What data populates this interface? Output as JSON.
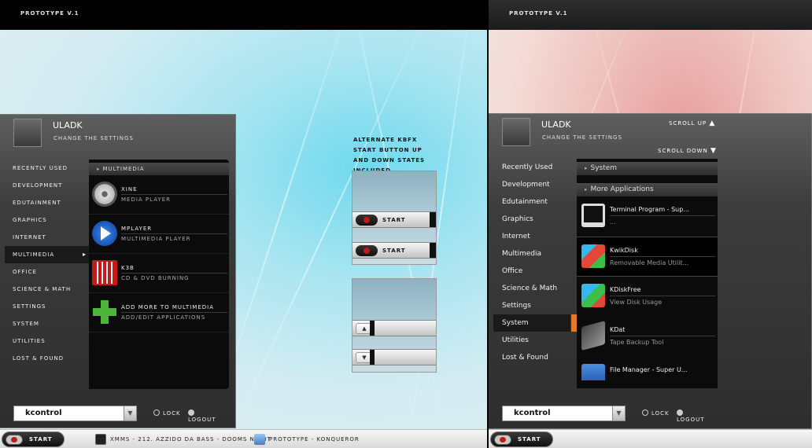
{
  "left": {
    "title": "PROTOTYPE V.1",
    "menu": {
      "user": "ULADK",
      "subtitle": "CHANGE THE SETTINGS",
      "categories": [
        "RECENTLY USED",
        "DEVELOPMENT",
        "EDUTAINMENT",
        "GRAPHICS",
        "INTERNET",
        "MULTIMEDIA",
        "OFFICE",
        "SCIENCE & MATH",
        "SETTINGS",
        "SYSTEM",
        "UTILITIES",
        "LOST & FOUND"
      ],
      "selected_category": "MULTIMEDIA",
      "section": "MULTIMEDIA",
      "apps": [
        {
          "name": "XINE",
          "desc": "MEDIA PLAYER",
          "icon": "xine-disc-icon"
        },
        {
          "name": "MPLAYER",
          "desc": "MULTIMEDIA PLAYER",
          "icon": "mplayer-play-icon"
        },
        {
          "name": "K3B",
          "desc": "CD & DVD BURNING",
          "icon": "k3b-icon"
        },
        {
          "name": "ADD MORE TO MULTIMEDIA",
          "desc": "ADD/EDIT APPLICATIONS",
          "icon": "add-plus-icon"
        }
      ],
      "command_value": "kcontrol",
      "lock": "LOCK",
      "logout": "LOGOUT"
    },
    "note": "ALTERNATE KBFX START BUTTON UP AND DOWN STATES INCLUDED",
    "start_label": "START",
    "taskbar": {
      "start": "START",
      "tasks": [
        "XMMS - 212. AZZIDO DA BASS - DOOMS NIGHT",
        "PROTOTYPE - KONQUEROR"
      ]
    }
  },
  "right": {
    "title": "PROTOTYPE V.1",
    "menu": {
      "user": "ULADK",
      "subtitle": "CHANGE THE SETTINGS",
      "scroll_up": "SCROLL UP",
      "scroll_down": "SCROLL DOWN",
      "categories": [
        "Recently Used",
        "Development",
        "Edutainment",
        "Graphics",
        "Internet",
        "Multimedia",
        "Office",
        "Science & Math",
        "Settings",
        "System",
        "Utilities",
        "Lost & Found"
      ],
      "selected_category": "System",
      "section1": "System",
      "section2": "More Applications",
      "apps": [
        {
          "name": "Terminal Program - Sup...",
          "desc": "...",
          "icon": "terminal-icon"
        },
        {
          "name": "KwikDisk",
          "desc": "Removable Media Utilit...",
          "icon": "kwikdisk-cubes-icon"
        },
        {
          "name": "KDiskFree",
          "desc": "View Disk Usage",
          "icon": "kdiskfree-cubes-icon"
        },
        {
          "name": "KDat",
          "desc": "Tape Backup Tool",
          "icon": "kdat-tape-icon"
        },
        {
          "name": "File Manager - Super U...",
          "desc": "",
          "icon": "file-manager-icon"
        }
      ],
      "command_value": "kcontrol",
      "lock": "LOCK",
      "logout": "LOGOUT"
    },
    "taskbar": {
      "start": "START"
    }
  },
  "colors": {
    "accent": "#e07a2a",
    "start_red": "#c01818",
    "menu_bg": "#2e2e2e"
  }
}
